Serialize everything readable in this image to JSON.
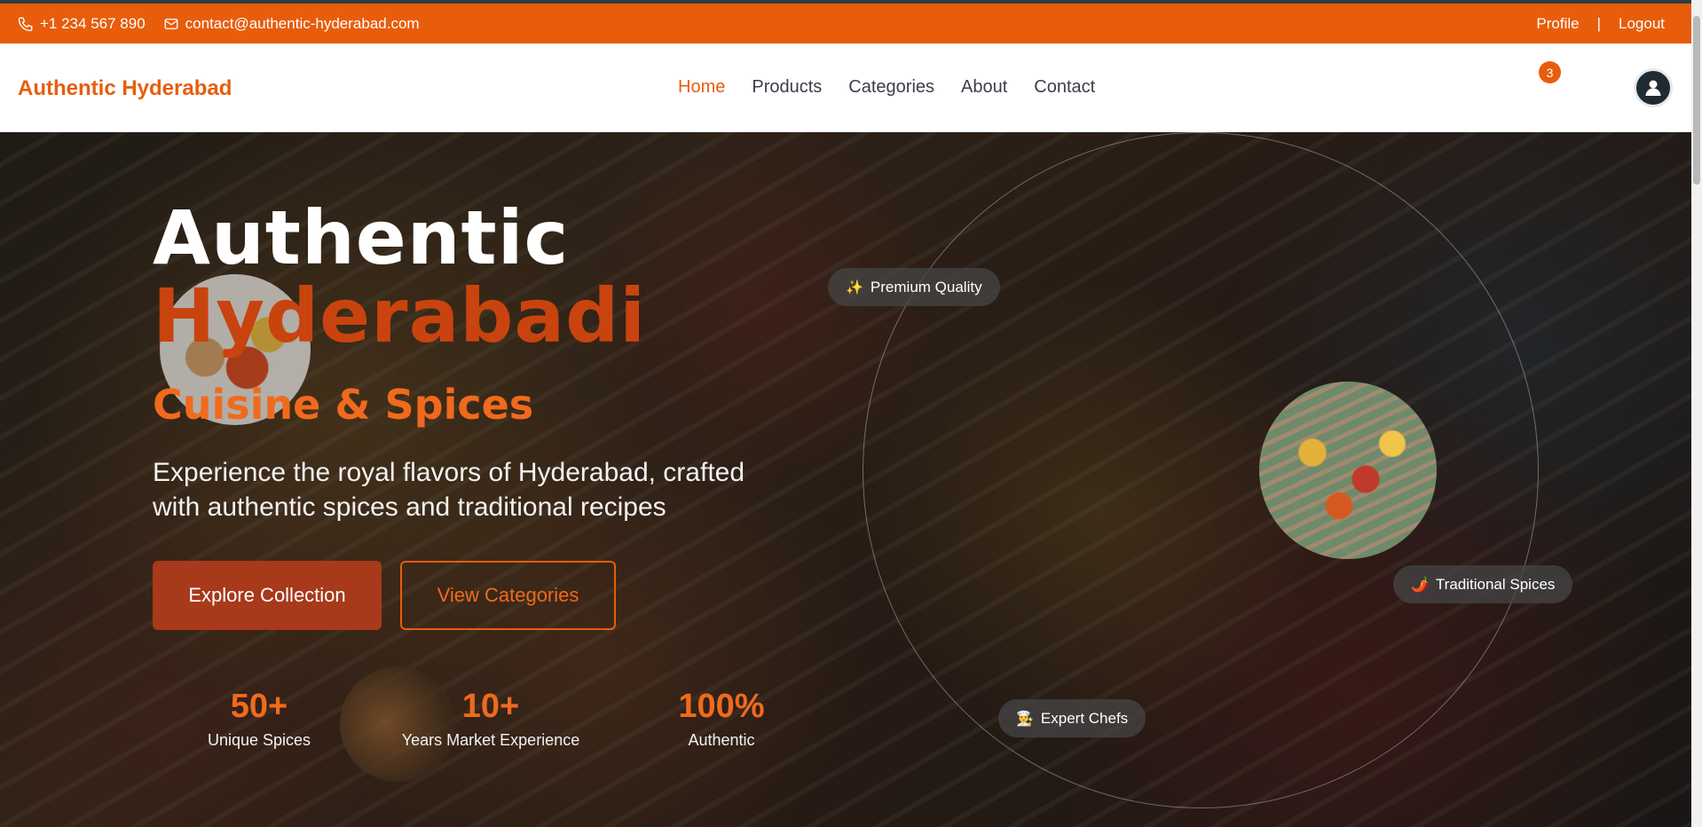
{
  "topbar": {
    "phone": "+1 234 567 890",
    "email": "contact@authentic-hyderabad.com",
    "profile_label": "Profile",
    "separator": "|",
    "logout_label": "Logout"
  },
  "navbar": {
    "brand": "Authentic Hyderabad",
    "menu": [
      {
        "label": "Home",
        "active": true
      },
      {
        "label": "Products",
        "active": false
      },
      {
        "label": "Categories",
        "active": false
      },
      {
        "label": "About",
        "active": false
      },
      {
        "label": "Contact",
        "active": false
      }
    ],
    "wishlist_count": "3",
    "icons": [
      "heart-icon",
      "shopping-bag-icon",
      "user-icon"
    ]
  },
  "hero": {
    "title_line1": "Authentic",
    "title_line2": "Hyderabadi",
    "title_line3": "Cuisine & Spices",
    "subtitle": "Experience the royal flavors of Hyderabad, crafted with authentic spices and traditional recipes",
    "primary_button": "Explore Collection",
    "secondary_button": "View Categories",
    "stats": [
      {
        "value": "50+",
        "label": "Unique Spices"
      },
      {
        "value": "10+",
        "label": "Years Market Experience"
      },
      {
        "value": "100%",
        "label": "Authentic"
      }
    ],
    "chips": [
      {
        "icon": "✨",
        "label": "Premium Quality"
      },
      {
        "icon": "🌶️",
        "label": "Traditional Spices"
      },
      {
        "icon": "👨‍🍳",
        "label": "Expert Chefs"
      }
    ]
  },
  "colors": {
    "accent": "#e85d0c",
    "primary_button": "#a8391a",
    "title_secondary": "#c9430e",
    "topbar_border": "#2f3b45"
  }
}
